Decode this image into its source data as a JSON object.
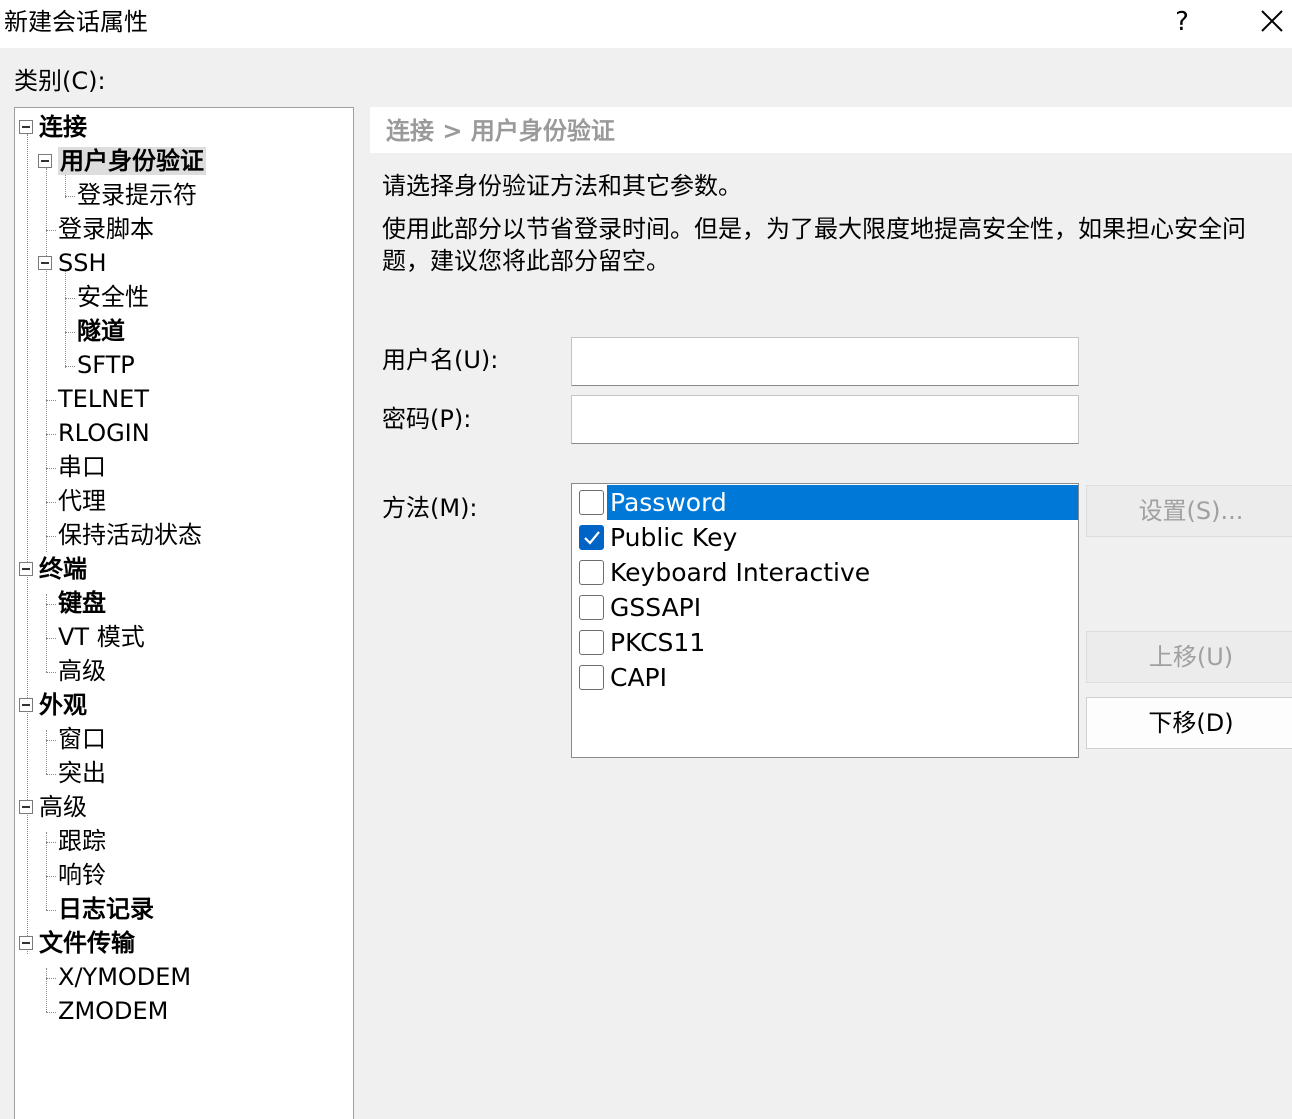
{
  "window": {
    "title": "新建会话属性",
    "help": "?"
  },
  "category_label": "类别(C):",
  "tree": [
    {
      "label": "连接",
      "bold": true,
      "expanded": true
    },
    {
      "label": "用户身份验证",
      "bold": true,
      "expanded": true,
      "selected": true
    },
    {
      "label": "登录提示符"
    },
    {
      "label": "登录脚本"
    },
    {
      "label": "SSH",
      "expanded": true
    },
    {
      "label": "安全性"
    },
    {
      "label": "隧道",
      "bold": true
    },
    {
      "label": "SFTP"
    },
    {
      "label": "TELNET"
    },
    {
      "label": "RLOGIN"
    },
    {
      "label": "串口"
    },
    {
      "label": "代理"
    },
    {
      "label": "保持活动状态"
    },
    {
      "label": "终端",
      "bold": true,
      "expanded": true
    },
    {
      "label": "键盘",
      "bold": true
    },
    {
      "label": "VT 模式"
    },
    {
      "label": "高级"
    },
    {
      "label": "外观",
      "bold": true,
      "expanded": true
    },
    {
      "label": "窗口"
    },
    {
      "label": "突出"
    },
    {
      "label": "高级",
      "expanded": true
    },
    {
      "label": "跟踪"
    },
    {
      "label": "响铃"
    },
    {
      "label": "日志记录",
      "bold": true
    },
    {
      "label": "文件传输",
      "bold": true,
      "expanded": true
    },
    {
      "label": "X/YMODEM"
    },
    {
      "label": "ZMODEM"
    }
  ],
  "panel": {
    "breadcrumb": "连接 > 用户身份验证",
    "intro": "请选择身份验证方法和其它参数。",
    "note": "使用此部分以节省登录时间。但是，为了最大限度地提高安全性，如果担心安全问题，建议您将此部分留空。",
    "username_label": "用户名(U):",
    "username_value": "",
    "password_label": "密码(P):",
    "password_value": "",
    "method_label": "方法(M):",
    "methods": [
      {
        "label": "Password",
        "checked": false,
        "selected": true
      },
      {
        "label": "Public Key",
        "checked": true,
        "selected": false
      },
      {
        "label": "Keyboard Interactive",
        "checked": false,
        "selected": false
      },
      {
        "label": "GSSAPI",
        "checked": false,
        "selected": false
      },
      {
        "label": "PKCS11",
        "checked": false,
        "selected": false
      },
      {
        "label": "CAPI",
        "checked": false,
        "selected": false
      }
    ],
    "settings_button": "设置(S)...",
    "move_up_button": "上移(U)",
    "move_down_button": "下移(D)"
  },
  "colors": {
    "selection": "#0078d7",
    "checkbox_checked": "#0063c6",
    "dialog_bg": "#f0f0f0"
  }
}
